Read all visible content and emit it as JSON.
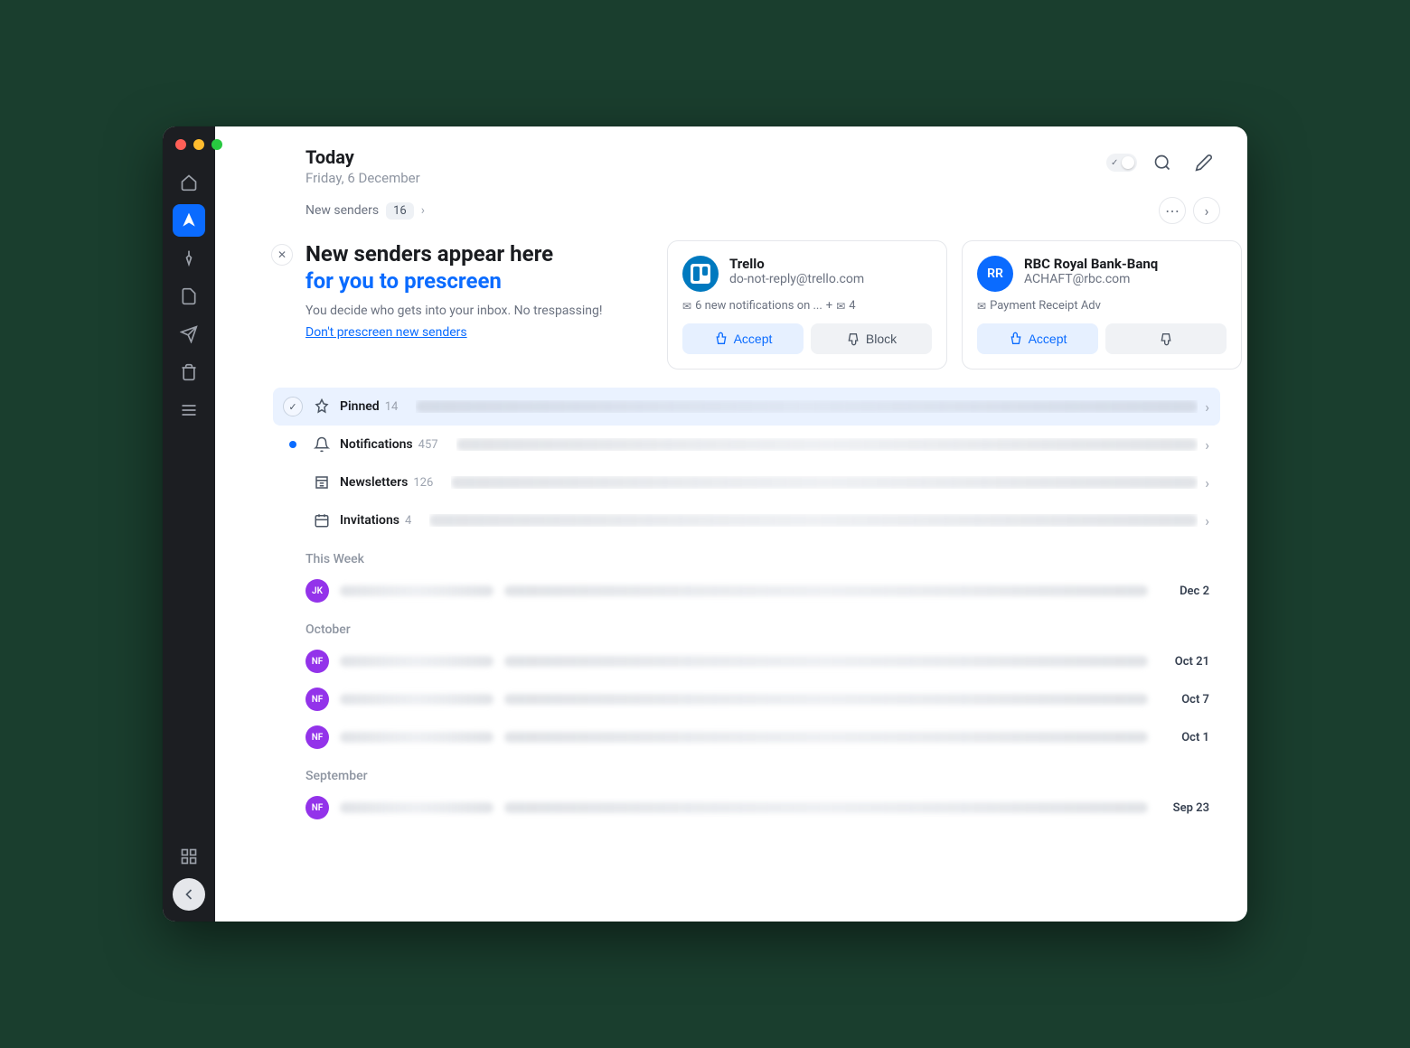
{
  "header": {
    "title": "Today",
    "date": "Friday, 6 December"
  },
  "crumb": {
    "label": "New senders",
    "count": "16"
  },
  "intro": {
    "line1": "New senders appear here",
    "line2": "for you to prescreen",
    "body": "You decide who gets into your inbox. No trespassing!",
    "link": "Don't prescreen new senders"
  },
  "cards": [
    {
      "name": "Trello",
      "email": "do-not-reply@trello.com",
      "preview": "6 new notifications on ...",
      "extra": "4",
      "avatar": "trello",
      "accept": "Accept",
      "block": "Block"
    },
    {
      "name": "RBC Royal Bank-Banq",
      "email": "ACHAFT@rbc.com",
      "preview": "Payment Receipt Adv",
      "extra": "",
      "avatar": "RR",
      "accept": "Accept",
      "block": ""
    }
  ],
  "groups": [
    {
      "label": "Pinned",
      "count": "14",
      "style": "pinned",
      "lead": "check"
    },
    {
      "label": "Notifications",
      "count": "457",
      "style": "",
      "lead": "dot"
    },
    {
      "label": "Newsletters",
      "count": "126",
      "style": "",
      "lead": ""
    },
    {
      "label": "Invitations",
      "count": "4",
      "style": "",
      "lead": ""
    }
  ],
  "sections": [
    {
      "label": "This Week",
      "rows": [
        {
          "avatar": "JK",
          "color": "#9333ea",
          "date": "Dec 2"
        }
      ]
    },
    {
      "label": "October",
      "rows": [
        {
          "avatar": "NF",
          "color": "#9333ea",
          "date": "Oct 21"
        },
        {
          "avatar": "NF",
          "color": "#9333ea",
          "date": "Oct 7"
        },
        {
          "avatar": "NF",
          "color": "#9333ea",
          "date": "Oct 1"
        }
      ]
    },
    {
      "label": "September",
      "rows": [
        {
          "avatar": "NF",
          "color": "#9333ea",
          "date": "Sep 23"
        }
      ]
    }
  ]
}
